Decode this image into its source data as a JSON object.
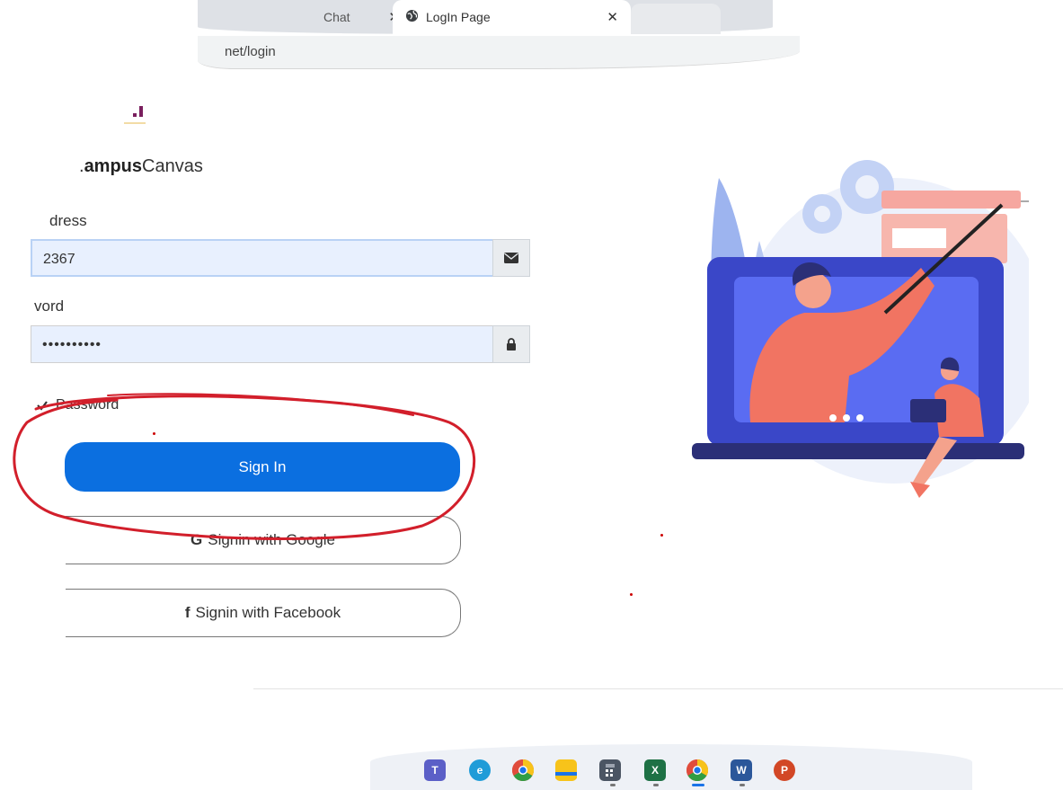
{
  "browser": {
    "tabs": [
      {
        "label": "Chat"
      },
      {
        "label": "LogIn Page"
      }
    ],
    "close_glyph": "✕",
    "address": "net/login"
  },
  "login": {
    "brand_bold": "ampus",
    "brand_regular": "Canvas",
    "email_label": "dress",
    "email_value": "2367",
    "password_label": "vord",
    "password_value": "••••••••••",
    "show_password_label": "Password",
    "signin_label": "Sign In",
    "google_label": "Signin with Google",
    "facebook_label": "Signin with Facebook"
  },
  "icons": {
    "email": "envelope-icon",
    "password": "lock-icon",
    "google": "google-g-icon",
    "facebook": "facebook-f-icon"
  },
  "colors": {
    "primary_button": "#0b6fe0",
    "input_fill": "#e8f0fe",
    "annotation": "#d21f2b",
    "brand_accent": "#7a1f5e"
  },
  "taskbar": {
    "apps": [
      "teams",
      "edge",
      "chrome",
      "file-explorer",
      "calculator",
      "excel",
      "chrome-active",
      "word",
      "powerpoint"
    ]
  }
}
